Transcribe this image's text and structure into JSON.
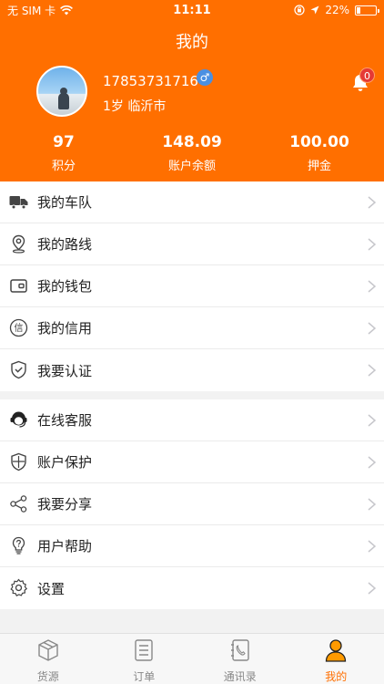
{
  "status_bar": {
    "carrier": "无 SIM 卡",
    "time": "11:11",
    "battery_percent": "22%",
    "battery_level": 0.22
  },
  "header": {
    "title": "我的",
    "phone": "17853731716",
    "gender_symbol": "♂",
    "age_city": "1岁 临沂市",
    "notification_count": "0"
  },
  "stats": [
    {
      "value": "97",
      "label": "积分"
    },
    {
      "value": "148.09",
      "label": "账户余额"
    },
    {
      "value": "100.00",
      "label": "押金"
    }
  ],
  "menu_group_1": [
    {
      "label": "我的车队",
      "icon": "truck-icon"
    },
    {
      "label": "我的路线",
      "icon": "location-pin-icon"
    },
    {
      "label": "我的钱包",
      "icon": "wallet-icon"
    },
    {
      "label": "我的信用",
      "icon": "credit-icon"
    },
    {
      "label": "我要认证",
      "icon": "shield-check-icon"
    }
  ],
  "menu_group_2": [
    {
      "label": "在线客服",
      "icon": "headset-icon"
    },
    {
      "label": "账户保护",
      "icon": "shield-icon"
    },
    {
      "label": "我要分享",
      "icon": "share-icon"
    },
    {
      "label": "用户帮助",
      "icon": "help-bulb-icon"
    },
    {
      "label": "设置",
      "icon": "gear-icon"
    }
  ],
  "credit_icon_glyph": "信",
  "tabs": [
    {
      "label": "货源",
      "icon": "box-icon",
      "active": false
    },
    {
      "label": "订单",
      "icon": "order-list-icon",
      "active": false
    },
    {
      "label": "通讯录",
      "icon": "contacts-icon",
      "active": false
    },
    {
      "label": "我的",
      "icon": "person-icon",
      "active": true
    }
  ],
  "colors": {
    "brand": "#ff6f00",
    "badge": "#e53935",
    "gender": "#4a90e2"
  }
}
